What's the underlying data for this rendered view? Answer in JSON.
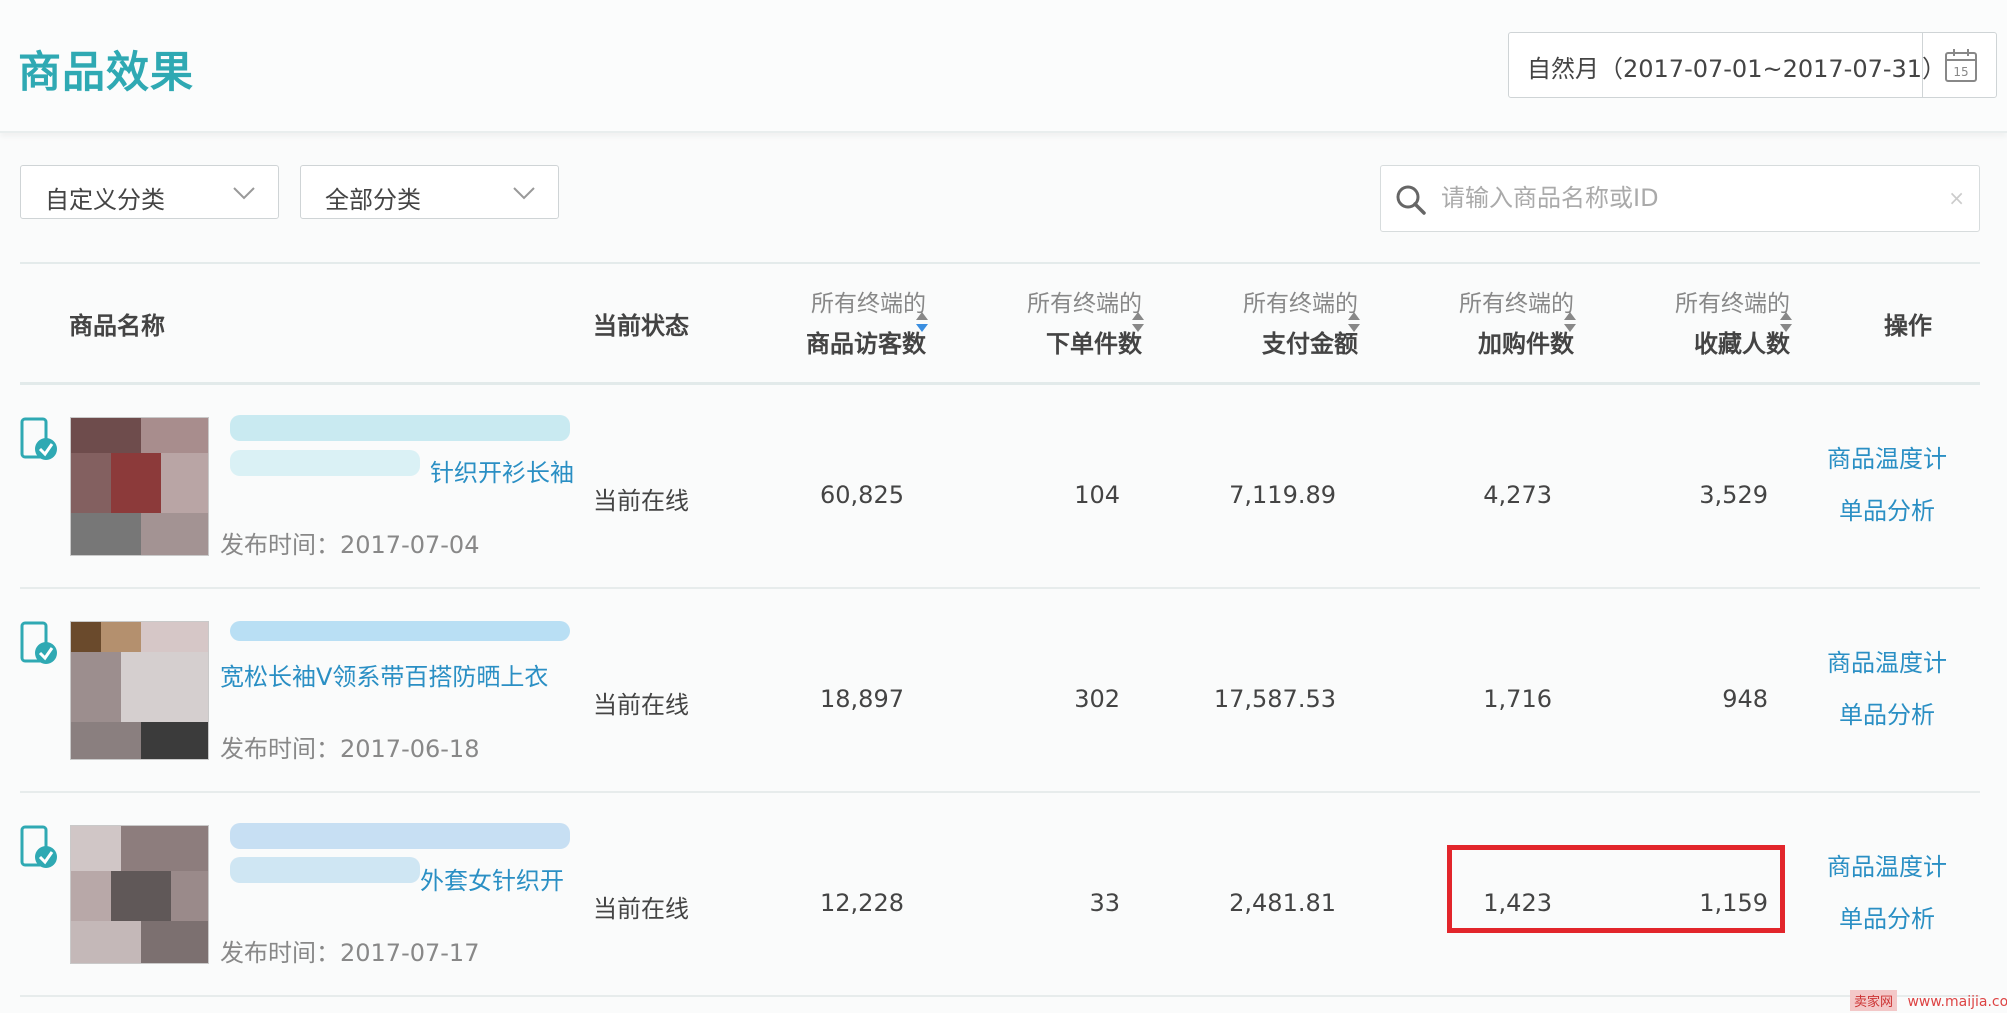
{
  "header": {
    "title": "商品效果",
    "date_range": "自然月（2017-07-01~2017-07-31）"
  },
  "filters": {
    "custom_category": "自定义分类",
    "all_category": "全部分类",
    "search_placeholder": "请输入商品名称或ID",
    "clear": "×"
  },
  "table": {
    "columns": {
      "name": "商品名称",
      "status": "当前状态",
      "visitors_l1": "所有终端的",
      "visitors_l2": "商品访客数",
      "orders_l1": "所有终端的",
      "orders_l2": "下单件数",
      "payment_l1": "所有终端的",
      "payment_l2": "支付金额",
      "cart_l1": "所有终端的",
      "cart_l2": "加购件数",
      "fav_l1": "所有终端的",
      "fav_l2": "收藏人数",
      "actions": "操作"
    },
    "rows": [
      {
        "name": "针织开衫长袖",
        "publish_time": "发布时间：2017-07-04",
        "status": "当前在线",
        "visitors": "60,825",
        "orders": "104",
        "payment": "7,119.89",
        "cart": "4,273",
        "fav": "3,529",
        "op1": "商品温度计",
        "op2": "单品分析"
      },
      {
        "name": "宽松长袖V领系带百搭防晒上衣",
        "publish_time": "发布时间：2017-06-18",
        "status": "当前在线",
        "visitors": "18,897",
        "orders": "302",
        "payment": "17,587.53",
        "cart": "1,716",
        "fav": "948",
        "op1": "商品温度计",
        "op2": "单品分析"
      },
      {
        "name": "外套女针织开",
        "publish_time": "发布时间：2017-07-17",
        "status": "当前在线",
        "visitors": "12,228",
        "orders": "33",
        "payment": "2,481.81",
        "cart": "1,423",
        "fav": "1,159",
        "op1": "商品温度计",
        "op2": "单品分析"
      }
    ]
  },
  "watermark": {
    "logo": "卖家网",
    "url": "www.maijia.com"
  },
  "colors": {
    "accent": "#2fa9b3",
    "link": "#2a8fc4",
    "highlight": "#e2252b"
  }
}
